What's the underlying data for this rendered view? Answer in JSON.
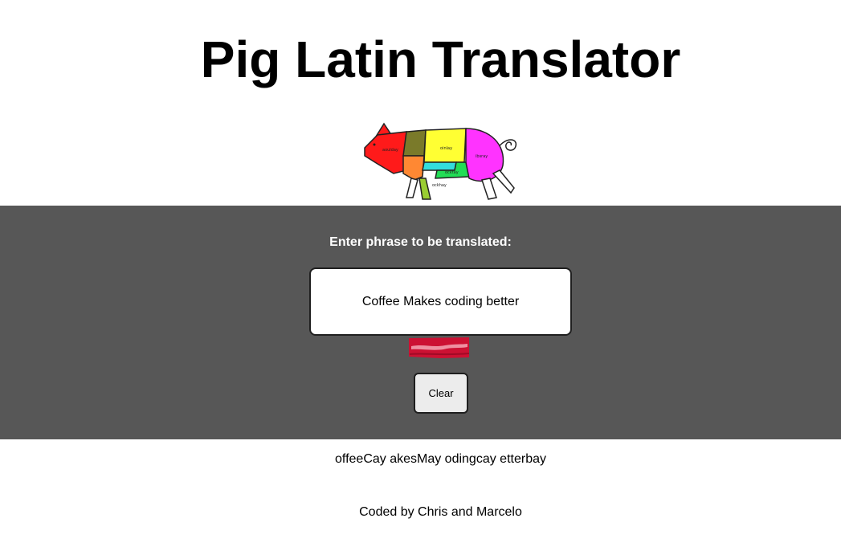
{
  "header": {
    "title": "Pig Latin Translator"
  },
  "pig_image": {
    "icon": "pig-cuts-diagram",
    "labels": [
      "aoulday",
      "oinlay",
      "ibsray",
      "ocktay",
      "ockhay"
    ]
  },
  "translator": {
    "prompt": "Enter phrase to be translated:",
    "input_value": "Coffee Makes coding better",
    "translate_icon": "bacon-strip-icon",
    "clear_label": "Clear"
  },
  "output": {
    "translation": "offeeCay akesMay odingcay etterbay"
  },
  "footer": {
    "credit": "Coded by Chris and Marcelo"
  },
  "colors": {
    "panel_bg": "#575757",
    "bacon_red": "#cc1133",
    "pig_red": "#ff1a1a",
    "pig_olive": "#7a7a2a",
    "pig_yellow": "#ffff33",
    "pig_magenta": "#ff33ff",
    "pig_orange": "#ff8833",
    "pig_cyan": "#33dddd",
    "pig_green": "#22dd55"
  }
}
